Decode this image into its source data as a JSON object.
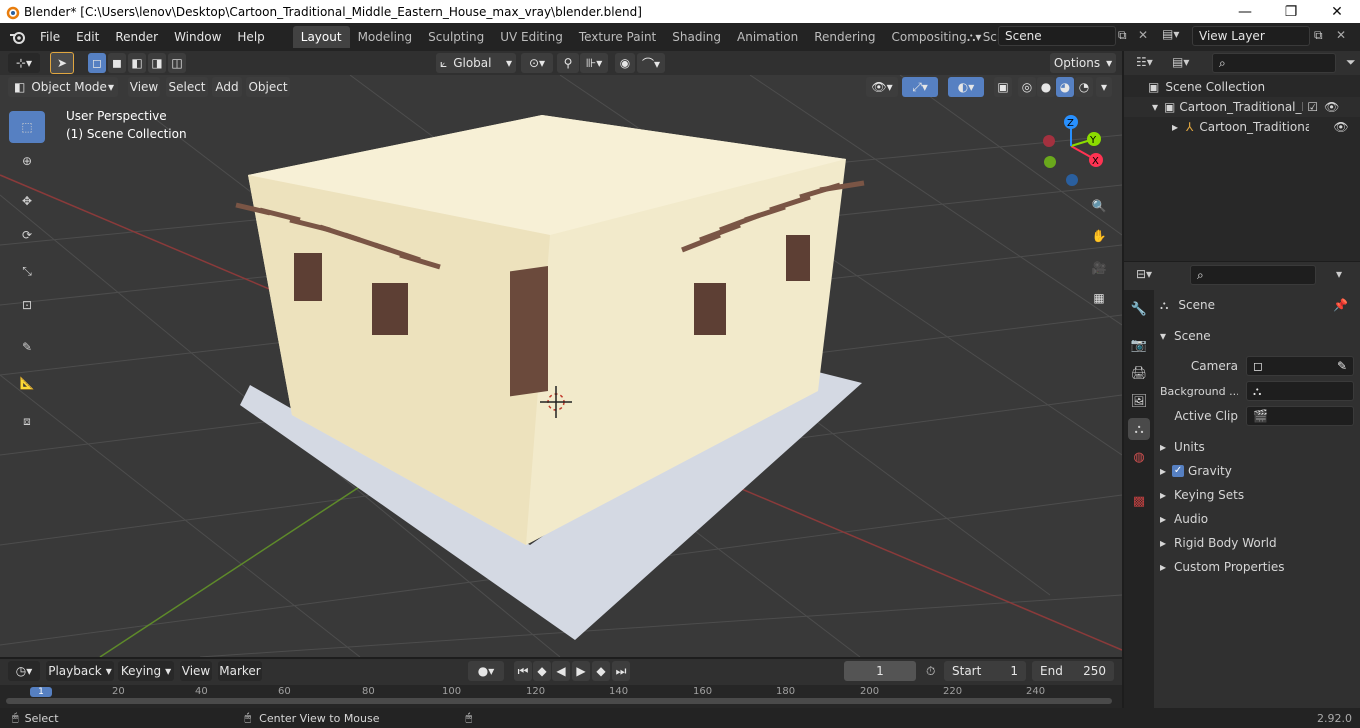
{
  "window": {
    "title": "Blender* [C:\\Users\\lenov\\Desktop\\Cartoon_Traditional_Middle_Eastern_House_max_vray\\blender.blend]",
    "minimize": "—",
    "maximize": "❐",
    "close": "✕"
  },
  "menus": [
    "File",
    "Edit",
    "Render",
    "Window",
    "Help"
  ],
  "workspaces": [
    "Layout",
    "Modeling",
    "Sculpting",
    "UV Editing",
    "Texture Paint",
    "Shading",
    "Animation",
    "Rendering",
    "Compositing",
    "Scripting"
  ],
  "active_workspace": "Layout",
  "scene_field": "Scene",
  "view_layer_field": "View Layer",
  "viewport_header": {
    "transform_orientation": "Global",
    "options_label": "Options",
    "mode": "Object Mode",
    "menus": [
      "View",
      "Select",
      "Add",
      "Object"
    ]
  },
  "viewport": {
    "perspective": "User Perspective",
    "collection": "(1) Scene Collection",
    "gizmo": {
      "x": "X",
      "y": "Y",
      "z": "Z"
    }
  },
  "outliner": {
    "root": "Scene Collection",
    "collection": "Cartoon_Traditional_Midd",
    "object": "Cartoon_Traditional_"
  },
  "properties": {
    "context": "Scene",
    "panel": "Scene",
    "camera_label": "Camera",
    "background_label": "Background ...",
    "active_clip_label": "Active Clip",
    "sections": [
      "Units",
      "Gravity",
      "Keying Sets",
      "Audio",
      "Rigid Body World",
      "Custom Properties"
    ],
    "gravity_checked": true
  },
  "timeline": {
    "menus": [
      "Playback",
      "Keying",
      "View",
      "Marker"
    ],
    "current_frame": "1",
    "start_label": "Start",
    "start": "1",
    "end_label": "End",
    "end": "250",
    "ticks": [
      "1",
      "20",
      "40",
      "60",
      "80",
      "100",
      "120",
      "140",
      "160",
      "180",
      "200",
      "220",
      "240"
    ]
  },
  "status": {
    "select": "Select",
    "center": "Center View to Mouse",
    "version": "2.92.0"
  },
  "colors": {
    "accent": "#5680c2",
    "active_workspace_bg": "#424242",
    "axis_x": "#ff3352",
    "axis_y": "#8bdc00",
    "axis_z": "#2890ff"
  }
}
